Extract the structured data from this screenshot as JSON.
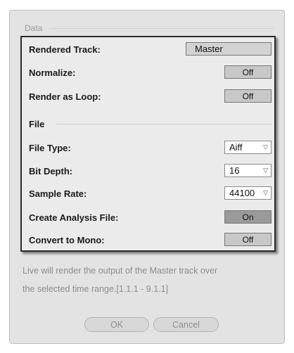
{
  "data_section": {
    "title": "Data"
  },
  "rows": {
    "rendered_track": {
      "label": "Rendered Track:",
      "value": "Master"
    },
    "normalize": {
      "label": "Normalize:",
      "value": "Off"
    },
    "render_as_loop": {
      "label": "Render as Loop:",
      "value": "Off"
    },
    "file_section": {
      "title": "File"
    },
    "file_type": {
      "label": "File Type:",
      "value": "Aiff"
    },
    "bit_depth": {
      "label": "Bit Depth:",
      "value": "16"
    },
    "sample_rate": {
      "label": "Sample Rate:",
      "value": "44100"
    },
    "create_analysis_file": {
      "label": "Create Analysis File:",
      "value": "On"
    },
    "convert_to_mono": {
      "label": "Convert to Mono:",
      "value": "Off"
    }
  },
  "info": {
    "line1": "Live will render the output of the Master track over",
    "line2": "the selected time range.[1.1.1 - 9.1.1]"
  },
  "buttons": {
    "ok": "OK",
    "cancel": "Cancel"
  },
  "colors": {
    "toggle_off": "#c8c8c8",
    "toggle_on": "#9a9a9a",
    "panel_border": "#2a2a2a"
  }
}
